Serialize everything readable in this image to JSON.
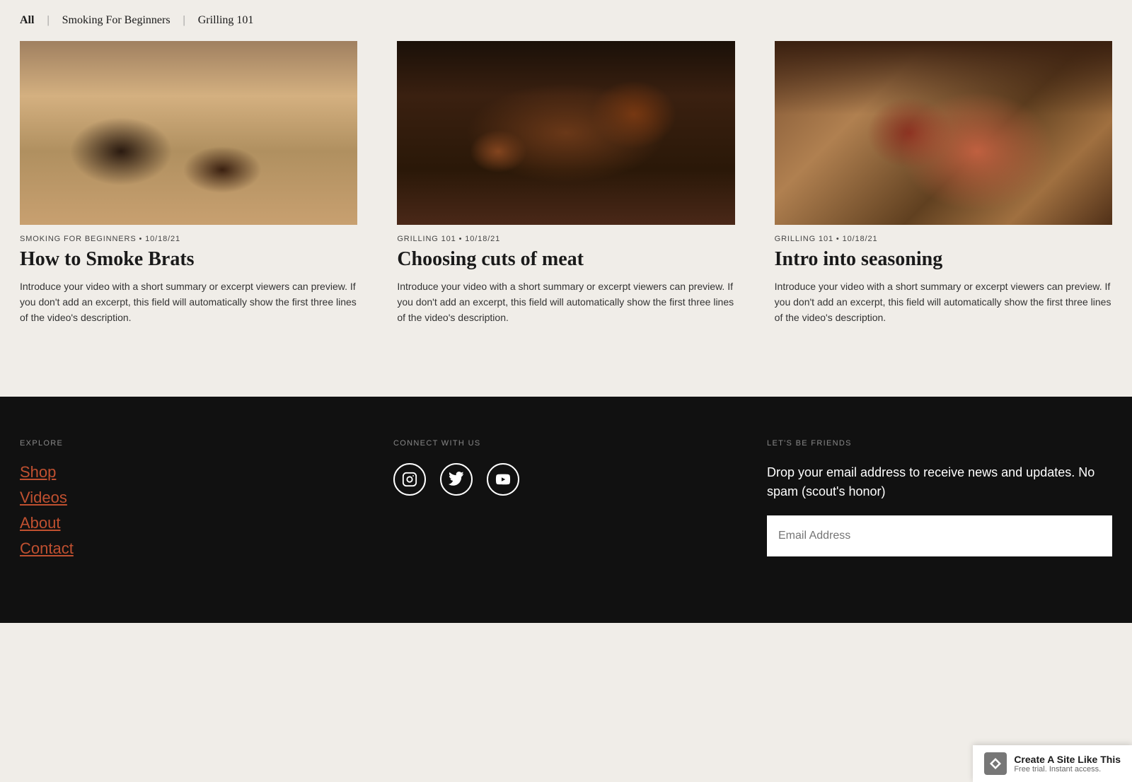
{
  "filter_nav": {
    "items": [
      {
        "label": "All",
        "active": true
      },
      {
        "label": "Smoking For Beginners",
        "active": false
      },
      {
        "label": "Grilling 101",
        "active": false
      }
    ]
  },
  "videos": [
    {
      "category": "SMOKING FOR BEGINNERS",
      "date": "10/18/21",
      "title": "How to Smoke Brats",
      "excerpt": "Introduce your video with a short summary or excerpt viewers can preview. If you don't add an excerpt, this field will automatically show the first three lines of the video's description.",
      "thumb_class": "thumb-1"
    },
    {
      "category": "GRILLING 101",
      "date": "10/18/21",
      "title": "Choosing cuts of meat",
      "excerpt": "Introduce your video with a short summary or excerpt viewers can preview. If you don't add an excerpt, this field will automatically show the first three lines of the video's description.",
      "thumb_class": "thumb-2"
    },
    {
      "category": "GRILLING 101",
      "date": "10/18/21",
      "title": "Intro into seasoning",
      "excerpt": "Introduce your video with a short summary or excerpt viewers can preview. If you don't add an excerpt, this field will automatically show the first three lines of the video's description.",
      "thumb_class": "thumb-3"
    }
  ],
  "footer": {
    "explore_title": "EXPLORE",
    "explore_links": [
      "Shop",
      "Videos",
      "About",
      "Contact"
    ],
    "connect_title": "CONNECT WITH US",
    "social_icons": [
      "instagram",
      "twitter",
      "youtube"
    ],
    "friends_title": "LET'S BE FRIENDS",
    "friends_text": "Drop your email address to receive news and updates. No spam (scout's honor)",
    "email_placeholder": "Email Address"
  },
  "badge": {
    "main": "Create A Site Like This",
    "sub": "Free trial. Instant access."
  }
}
